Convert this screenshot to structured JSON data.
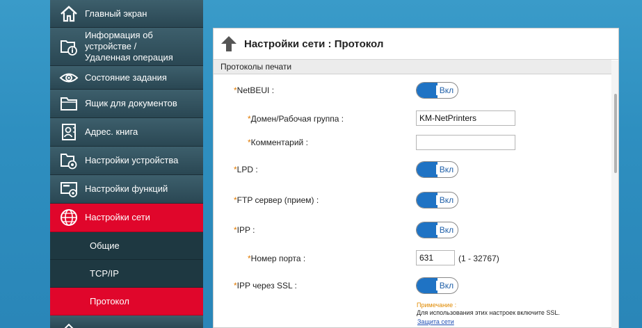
{
  "sidebar": {
    "items": [
      {
        "label": "Главный экран",
        "icon": "home-icon"
      },
      {
        "label": "Информация об устройстве / Удаленная операция",
        "icon": "device-info-icon"
      },
      {
        "label": "Состояние задания",
        "icon": "eye-icon"
      },
      {
        "label": "Ящик для документов",
        "icon": "folder-icon"
      },
      {
        "label": "Адрес. книга",
        "icon": "address-book-icon"
      },
      {
        "label": "Настройки устройства",
        "icon": "folder-gear-icon"
      },
      {
        "label": "Настройки функций",
        "icon": "printer-settings-icon"
      },
      {
        "label": "Настройки сети",
        "icon": "globe-icon"
      }
    ],
    "sub_items": [
      "Общие",
      "TCP/IP",
      "Протокол"
    ]
  },
  "page": {
    "title": "Настройки сети : Протокол",
    "section": "Протоколы печати"
  },
  "form": {
    "netbeui": {
      "label": "NetBEUI :",
      "state": "Вкл"
    },
    "domain": {
      "label": "Домен/Рабочая группа :",
      "value": "KM-NetPrinters"
    },
    "comment": {
      "label": "Комментарий :",
      "value": ""
    },
    "lpd": {
      "label": "LPD :",
      "state": "Вкл"
    },
    "ftp": {
      "label": "FTP сервер (прием) :",
      "state": "Вкл"
    },
    "ipp": {
      "label": "IPP :",
      "state": "Вкл"
    },
    "port": {
      "label": "Номер порта :",
      "value": "631",
      "range": "(1 - 32767)"
    },
    "ipp_ssl": {
      "label": "IPP через SSL :",
      "state": "Вкл"
    },
    "required_mark": "*"
  },
  "note": {
    "title": "Примечание :",
    "text": "Для использования этих настроек включите SSL.",
    "link": "Защита сети"
  },
  "colors": {
    "accent_red": "#e0062b",
    "toggle_blue": "#1f73c4",
    "sidebar_dark": "#2d4a56"
  }
}
